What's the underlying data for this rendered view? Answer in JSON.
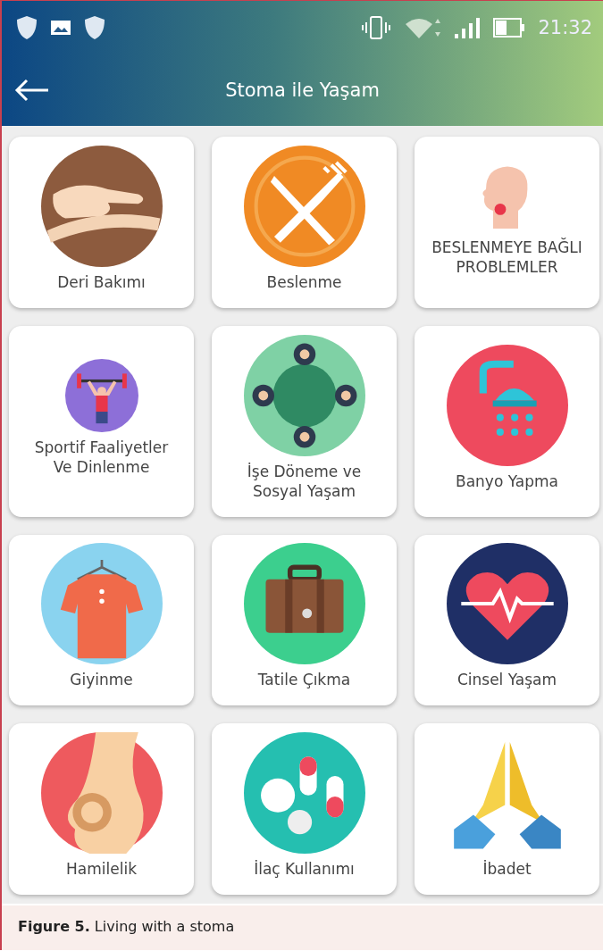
{
  "status_bar": {
    "time": "21:32"
  },
  "app_bar": {
    "title": "Stoma ile Yaşam"
  },
  "categories": [
    {
      "label": "Deri Bakımı"
    },
    {
      "label": "Beslenme"
    },
    {
      "label": "BESLENMEYE BAĞLI PROBLEMLER"
    },
    {
      "label": "Sportif Faaliyetler Ve Dinlenme"
    },
    {
      "label": "İşe Döneme ve Sosyal Yaşam"
    },
    {
      "label": "Banyo Yapma"
    },
    {
      "label": "Giyinme"
    },
    {
      "label": "Tatile Çıkma"
    },
    {
      "label": "Cinsel Yaşam"
    },
    {
      "label": "Hamilelik"
    },
    {
      "label": "İlaç Kullanımı"
    },
    {
      "label": "İbadet"
    }
  ],
  "caption": "**Figure 5.** Living with a stoma"
}
